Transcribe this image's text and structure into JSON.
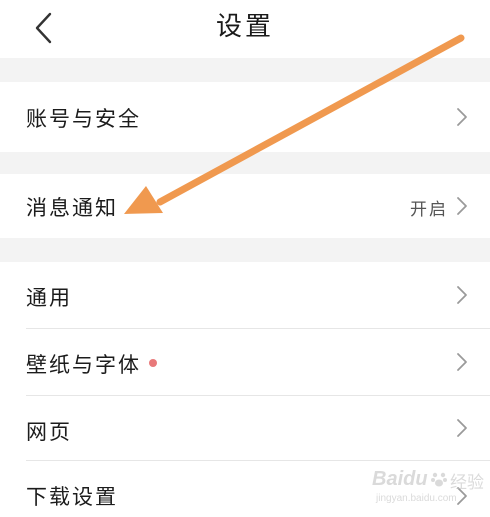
{
  "header": {
    "title": "设置",
    "back_icon": "chevron-left-icon"
  },
  "sections": [
    {
      "items": [
        {
          "label": "账号与安全",
          "value": "",
          "icon": "chevron-right-icon"
        }
      ]
    },
    {
      "items": [
        {
          "label": "消息通知",
          "value": "开启",
          "icon": "chevron-right-icon"
        }
      ]
    },
    {
      "items": [
        {
          "label": "通用",
          "value": "",
          "icon": "chevron-right-icon"
        },
        {
          "label": "壁纸与字体",
          "value": "",
          "badge": "red-dot",
          "icon": "chevron-right-icon"
        },
        {
          "label": "网页",
          "value": "",
          "icon": "chevron-right-icon"
        },
        {
          "label": "下载设置",
          "value": "",
          "icon": "chevron-right-icon"
        }
      ]
    }
  ],
  "annotation": {
    "type": "arrow",
    "color": "#f0994f",
    "points_to": "消息通知"
  },
  "watermark": {
    "brand": "Baidu",
    "suffix": "经验",
    "url": "jingyan.baidu.com"
  },
  "colors": {
    "background": "#ffffff",
    "section_gap": "#f3f3f3",
    "text": "#1c1c1c",
    "secondary_text": "#555555",
    "chevron": "#9a9a9a",
    "badge_dot": "#e8797a"
  }
}
